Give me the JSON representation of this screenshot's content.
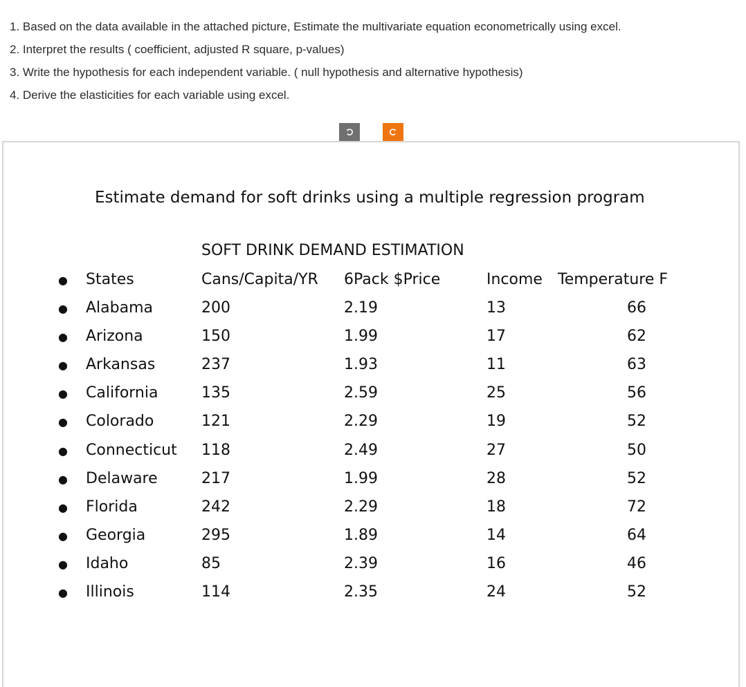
{
  "questions": [
    "1. Based on the data available in the attached picture, Estimate the multivariate equation econometrically using excel.",
    "2. Interpret the results ( coefficient, adjusted R square, p-values)",
    "3. Write the hypothesis for each independent variable. ( null hypothesis and alternative hypothesis)",
    "4. Derive the elasticities for each variable using excel."
  ],
  "toolbar": {
    "rotate_left_icon": "rotate-counterclockwise",
    "rotate_right_icon": "rotate-clockwise",
    "accent_color": "#ee7512"
  },
  "slide": {
    "title": "Estimate demand for soft drinks using a multiple regression program",
    "table_heading": "SOFT DRINK DEMAND ESTIMATION",
    "columns": [
      "States",
      "Cans/Capita/YR",
      "6Pack $Price",
      "Income",
      "Temperature F"
    ],
    "rows": [
      {
        "state": "Alabama",
        "cans": "200",
        "price": "2.19",
        "income": "13",
        "temp": "66"
      },
      {
        "state": "Arizona",
        "cans": "150",
        "price": "1.99",
        "income": "17",
        "temp": "62"
      },
      {
        "state": "Arkansas",
        "cans": "237",
        "price": "1.93",
        "income": "11",
        "temp": "63"
      },
      {
        "state": "California",
        "cans": "135",
        "price": "2.59",
        "income": "25",
        "temp": "56"
      },
      {
        "state": "Colorado",
        "cans": "121",
        "price": "2.29",
        "income": "19",
        "temp": "52"
      },
      {
        "state": "Connecticut",
        "cans": "118",
        "price": "2.49",
        "income": "27",
        "temp": "50"
      },
      {
        "state": "Delaware",
        "cans": "217",
        "price": "1.99",
        "income": "28",
        "temp": "52"
      },
      {
        "state": "Florida",
        "cans": "242",
        "price": "2.29",
        "income": "18",
        "temp": "72"
      },
      {
        "state": "Georgia",
        "cans": "295",
        "price": "1.89",
        "income": "14",
        "temp": "64"
      },
      {
        "state": "Idaho",
        "cans": "85",
        "price": "2.39",
        "income": "16",
        "temp": "46"
      },
      {
        "state": "Illinois",
        "cans": "114",
        "price": "2.35",
        "income": "24",
        "temp": "52"
      }
    ]
  }
}
